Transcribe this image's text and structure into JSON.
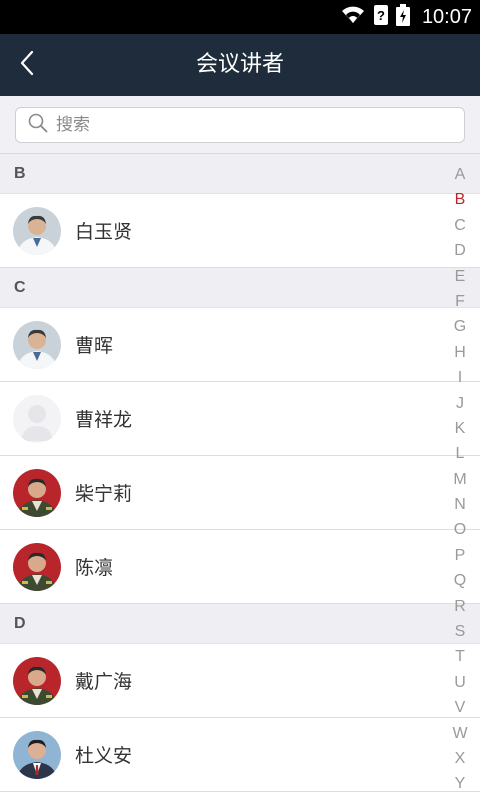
{
  "status_bar": {
    "time": "10:07"
  },
  "header": {
    "title": "会议讲者",
    "back_icon": "chevron-left-icon"
  },
  "search": {
    "placeholder": "搜索",
    "value": ""
  },
  "sections": [
    {
      "letter": "B",
      "items": [
        {
          "name": "白玉贤",
          "avatar": "doctor-white-coat"
        }
      ]
    },
    {
      "letter": "C",
      "items": [
        {
          "name": "曹晖",
          "avatar": "doctor-white-coat"
        },
        {
          "name": "曹祥龙",
          "avatar": "default-avatar"
        },
        {
          "name": "柴宁莉",
          "avatar": "military-uniform"
        },
        {
          "name": "陈凛",
          "avatar": "military-uniform"
        }
      ]
    },
    {
      "letter": "D",
      "items": [
        {
          "name": "戴广海",
          "avatar": "military-uniform"
        },
        {
          "name": "杜义安",
          "avatar": "suit"
        }
      ]
    }
  ],
  "index_bar": {
    "letters": [
      "A",
      "B",
      "C",
      "D",
      "E",
      "F",
      "G",
      "H",
      "I",
      "J",
      "K",
      "L",
      "M",
      "N",
      "O",
      "P",
      "Q",
      "R",
      "S",
      "T",
      "U",
      "V",
      "W",
      "X",
      "Y"
    ],
    "active": "B"
  },
  "colors": {
    "nav_bg": "#1e2c3b",
    "active_index": "#c0242d"
  }
}
